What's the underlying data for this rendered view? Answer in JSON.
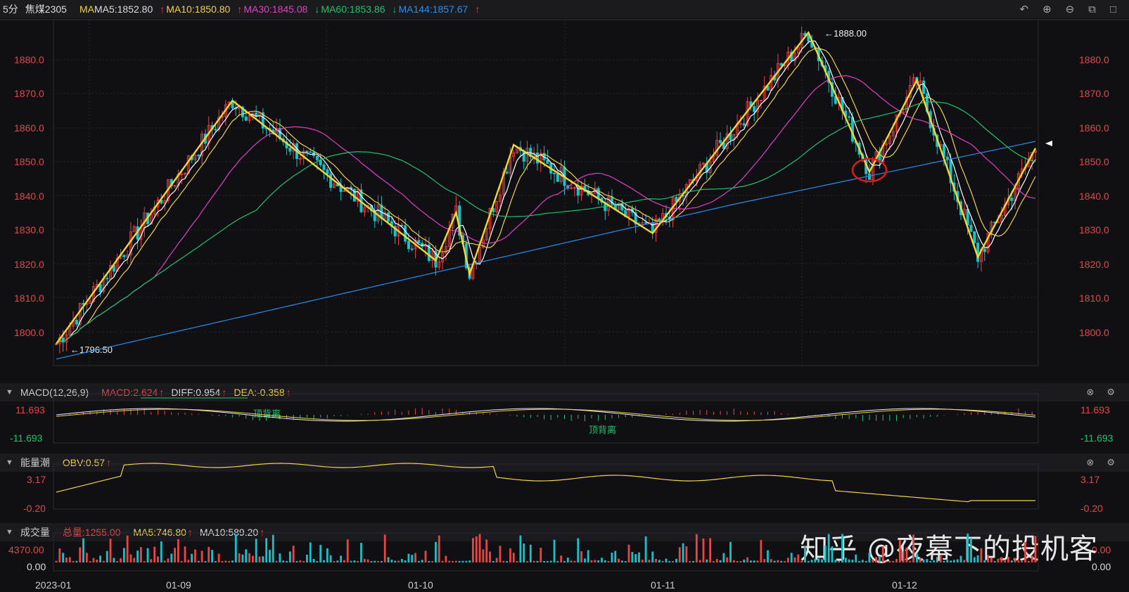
{
  "header": {
    "period": "5分",
    "symbol": "焦煤2305",
    "ma_label": "MA",
    "ma5": "MA5:1852.80",
    "ma10": "MA10:1850.80",
    "ma30": "MA30:1845.08",
    "ma60": "MA60:1853.86",
    "ma144": "MA144:1857.67",
    "up": "↑",
    "down": "↓",
    "colors": {
      "ma5": "#ffffff",
      "ma10": "#f0d24a",
      "ma30": "#e040c0",
      "ma60": "#22c36a",
      "ma144": "#2a8ee8"
    }
  },
  "main_axis": {
    "left_ticks": [
      "1880.0",
      "1870.0",
      "1860.0",
      "1850.0",
      "1840.0",
      "1830.0",
      "1820.0",
      "1810.0",
      "1800.0"
    ],
    "right_ticks": [
      "1880.0",
      "1870.0",
      "1860.0",
      "1850.0",
      "1840.0",
      "1830.0",
      "1820.0",
      "1810.0",
      "1800.0"
    ]
  },
  "annotations": {
    "high": "←1888.00",
    "low": "←1796.50"
  },
  "macd": {
    "title": "MACD(12,26,9)",
    "macd": "MACD:2.624",
    "diff": "DIFF:0.954",
    "dea": "DEA:-0.358",
    "up": "↑",
    "top": "11.693",
    "bottom": "-11.693",
    "div1": "顶背离",
    "div2": "顶背离"
  },
  "obv": {
    "title": "能量潮",
    "value": "OBV:0.57",
    "up": "↑",
    "top": "3.17",
    "bottom": "-0.20"
  },
  "volume": {
    "title": "成交量",
    "total": "总量:1255.00",
    "ma5": "MA5:746.80",
    "ma10": "MA10:589.20",
    "up": "↑",
    "top": "4370.00",
    "bottom": "0.00",
    "right_top": "0.00",
    "right_bottom": "0.00"
  },
  "x_labels": [
    "2023-01",
    "01-09",
    "01-10",
    "01-11",
    "01-12"
  ],
  "watermark": "知乎 @夜幕下的投机客"
}
